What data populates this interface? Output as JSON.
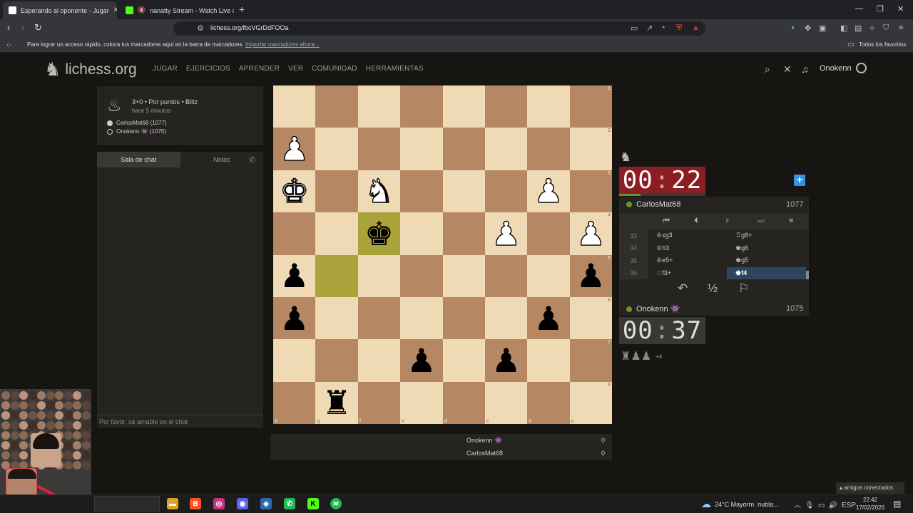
{
  "browser": {
    "tabs": [
      {
        "title": "Esperando al oponente - Jugar",
        "active": true
      },
      {
        "title": "nanatty Stream - Watch Live on",
        "active": false
      }
    ],
    "url": "lichess.org/fbcVGrDdFOOa",
    "bookmarks_message": "Para lograr un acceso rápido, coloca tus marcadores aquí en la barra de marcadores.",
    "bookmarks_link": "Importar marcadores ahora...",
    "all_favorites": "Todos los favoritos"
  },
  "site": {
    "logo": "lichess.org",
    "nav": [
      "JUGAR",
      "EJERCICIOS",
      "APRENDER",
      "VER",
      "COMUNIDAD",
      "HERRAMIENTAS"
    ],
    "username": "Onokenn"
  },
  "game": {
    "title": "3+0 • Por puntos • Blitz",
    "time_ago": "hace 5 minutos",
    "white_player": "CarlosMat68 (1077)",
    "black_player": "Onokenn 👾 (1075)"
  },
  "chat": {
    "tab_chat": "Sala de chat",
    "tab_notes": "Notas",
    "placeholder": "Por favor, sé amable en el chat"
  },
  "board": {
    "orientation": "black",
    "ranks_top_to_bottom": [
      "1",
      "2",
      "3",
      "4",
      "5",
      "6",
      "7",
      "8"
    ],
    "files_left_to_right": [
      "h",
      "g",
      "f",
      "e",
      "d",
      "c",
      "b",
      "a"
    ],
    "last_move_squares": [
      "f4",
      "g5"
    ],
    "squares_rows": [
      [
        "",
        "",
        "",
        "",
        "",
        "",
        "",
        ""
      ],
      [
        "P",
        "",
        "",
        "",
        "",
        "",
        "",
        ""
      ],
      [
        "K",
        "",
        "N",
        "",
        "",
        "",
        "P",
        ""
      ],
      [
        "",
        "",
        "k",
        "",
        "",
        "P",
        "",
        "P"
      ],
      [
        "p",
        "",
        "",
        "",
        "",
        "",
        "",
        "p"
      ],
      [
        "p",
        "",
        "",
        "",
        "",
        "",
        "p",
        ""
      ],
      [
        "",
        "",
        "",
        "p",
        "",
        "p",
        "",
        ""
      ],
      [
        "",
        "r",
        "",
        "",
        "",
        "",
        "",
        ""
      ]
    ]
  },
  "scoreboard": [
    {
      "name": "Onokenn 👾",
      "score": "0"
    },
    {
      "name": "CarlosMat68",
      "score": "0"
    }
  ],
  "top_player": {
    "name": "CarlosMat68",
    "rating": "1077",
    "clock_min": "00",
    "clock_sec": "22"
  },
  "bottom_player": {
    "name": "Onokenn 👾",
    "rating": "1075",
    "clock_min": "00",
    "clock_sec": "37"
  },
  "moves": [
    {
      "num": "33",
      "white": "♔xg3",
      "black": "♖g8+"
    },
    {
      "num": "34",
      "white": "♔h3",
      "black": "♚g6"
    },
    {
      "num": "35",
      "white": "♔e5+",
      "black": "♚g5"
    },
    {
      "num": "36",
      "white": "♘f3+",
      "black": "♚f4"
    }
  ],
  "captured": {
    "pieces": "♜♟♟",
    "diff": "+4"
  },
  "friends": "▴ amigos conectados",
  "taskbar": {
    "weather": "24°C  Mayorm. nubla...",
    "lang": "ESP",
    "time": "22:42",
    "date": "17/02/2026"
  },
  "colors": {
    "accent": "#629924",
    "clock_low": "#8a1e22",
    "light_square": "#f0d9b5",
    "dark_square": "#b58863",
    "highlight": "#aaa23a"
  }
}
